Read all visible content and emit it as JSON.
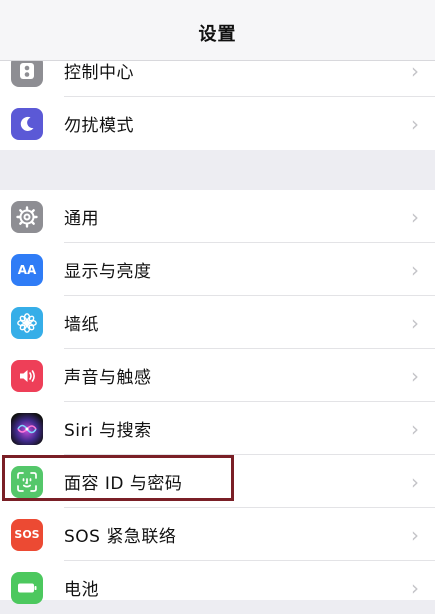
{
  "nav": {
    "title": "设置"
  },
  "groups": [
    {
      "items": [
        {
          "label": "控制中心",
          "icon": "control-center-icon"
        },
        {
          "label": "勿扰模式",
          "icon": "moon-icon"
        }
      ]
    },
    {
      "items": [
        {
          "label": "通用",
          "icon": "gear-icon"
        },
        {
          "label": "显示与亮度",
          "icon": "display-aa-icon",
          "icon_text": "AA"
        },
        {
          "label": "墙纸",
          "icon": "flower-icon"
        },
        {
          "label": "声音与触感",
          "icon": "speaker-icon"
        },
        {
          "label": "Siri 与搜索",
          "icon": "siri-icon"
        },
        {
          "label": "面容 ID 与密码",
          "icon": "face-id-icon"
        },
        {
          "label": "SOS 紧急联络",
          "icon": "sos-icon",
          "icon_text": "SOS"
        },
        {
          "label": "电池",
          "icon": "battery-icon"
        }
      ]
    }
  ],
  "highlight": {
    "target": "面容 ID 与密码",
    "color": "#7a1f26"
  },
  "chevron": "›"
}
